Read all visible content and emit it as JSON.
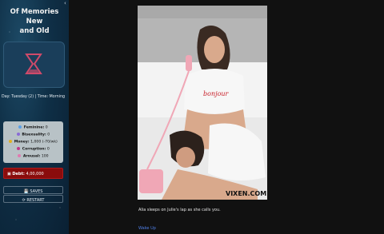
{
  "sidebar": {
    "title_line1": "Of Memories New",
    "title_line2": "and Old",
    "collapse_glyph": "‹",
    "day_time": "Day: Tuesday (2) | Time: Morning",
    "stats": [
      {
        "label": "Feminine:",
        "value": "0",
        "color": "#5aa0e6"
      },
      {
        "label": "Bisexuality:",
        "value": "0",
        "color": "#8a6bd6"
      },
      {
        "label": "Money:",
        "value": "1,000 (-70/wk)",
        "color": "#e0b020"
      },
      {
        "label": "Corruption:",
        "value": "0",
        "color": "#c0388a"
      },
      {
        "label": "Arousal:",
        "value": "100",
        "color": "#e07ab0"
      }
    ],
    "debt_label": "Debt:",
    "debt_value": "4,00,000",
    "saves_label": "SAVES",
    "restart_label": "RESTART"
  },
  "main": {
    "photo_watermark": "VIXEN.COM",
    "shirt_text": "bonjour",
    "caption": "Alia sleeps on Julie's lap as she calls you.",
    "link_label": "Wake Up"
  },
  "colors": {
    "sidebar_bg": "#0f2f46",
    "stats_bg": "#b8c2c6",
    "debt_bg": "#8a0c0c",
    "link": "#4f7fe6"
  }
}
